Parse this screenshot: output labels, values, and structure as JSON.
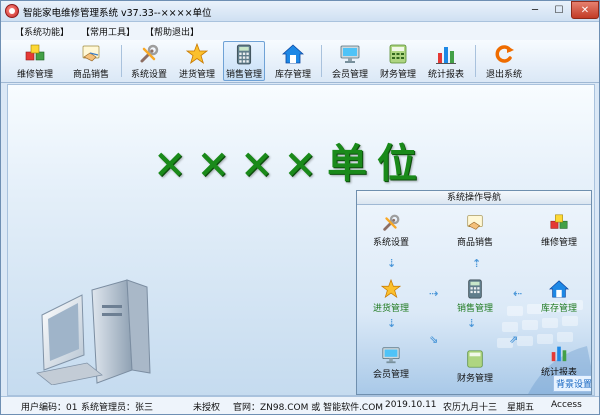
{
  "window": {
    "title": "智能家电维修管理系统 v37.33--××××单位"
  },
  "menu": [
    "【系统功能】",
    "【常用工具】",
    "【帮助退出】"
  ],
  "toolbar": [
    {
      "label": "维修管理",
      "icon": "cubes-icon"
    },
    {
      "label": "商品销售",
      "icon": "handshake-icon"
    },
    {
      "label": "系统设置",
      "icon": "tools-icon"
    },
    {
      "label": "进货管理",
      "icon": "star-icon"
    },
    {
      "label": "销售管理",
      "icon": "calculator-icon"
    },
    {
      "label": "库存管理",
      "icon": "house-icon"
    },
    {
      "label": "会员管理",
      "icon": "monitor-icon"
    },
    {
      "label": "财务管理",
      "icon": "cash-register-icon"
    },
    {
      "label": "统计报表",
      "icon": "bar-chart-icon"
    },
    {
      "label": "退出系统",
      "icon": "exit-icon"
    }
  ],
  "main": {
    "company_title": "××××单位"
  },
  "nav_panel": {
    "title": "系统操作导航",
    "nodes": {
      "settings": "系统设置",
      "sales_goods": "商品销售",
      "repair": "维修管理",
      "purchase": "进货管理",
      "sales": "销售管理",
      "inventory": "库存管理",
      "members": "会员管理",
      "finance": "财务管理",
      "reports": "统计报表"
    },
    "bg_settings": "背景设置"
  },
  "status": {
    "user_code": "用户编码：01",
    "admin": "系统管理员：张三",
    "license": "未授权",
    "website": "官网：ZN98.COM 或 智能软件.COM",
    "date": "2019.10.11",
    "lunar": "农历九月十三",
    "weekday": "星期五",
    "db": "Access"
  }
}
